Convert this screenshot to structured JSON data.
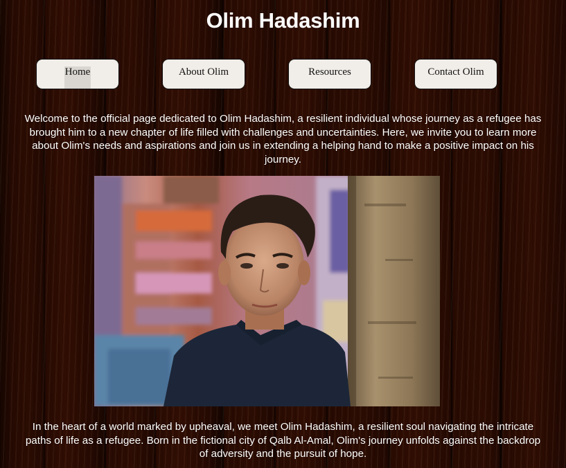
{
  "page": {
    "title": "Olim Hadashim"
  },
  "nav": {
    "items": [
      {
        "label": "Home"
      },
      {
        "label": "About Olim"
      },
      {
        "label": "Resources"
      },
      {
        "label": "Contact Olim"
      }
    ]
  },
  "intro": "Welcome to the official page dedicated to Olim Hadashim, a resilient individual whose journey as a refugee has brought him to a new chapter of life filled with challenges and uncertainties. Here, we invite you to learn more about Olim's needs and aspirations and join us in extending a helping hand to make a positive impact on his journey.",
  "story": "In the heart of a world marked by upheaval, we meet Olim Hadashim, a resilient soul navigating the intricate paths of life as a refugee. Born in the fictional city of Qalb Al-Amal, Olim's journey unfolds against the backdrop of adversity and the pursuit of hope.",
  "colors": {
    "nav_bg": "#f1ede8",
    "text": "#ffffff",
    "wood": "#5a2e14"
  }
}
